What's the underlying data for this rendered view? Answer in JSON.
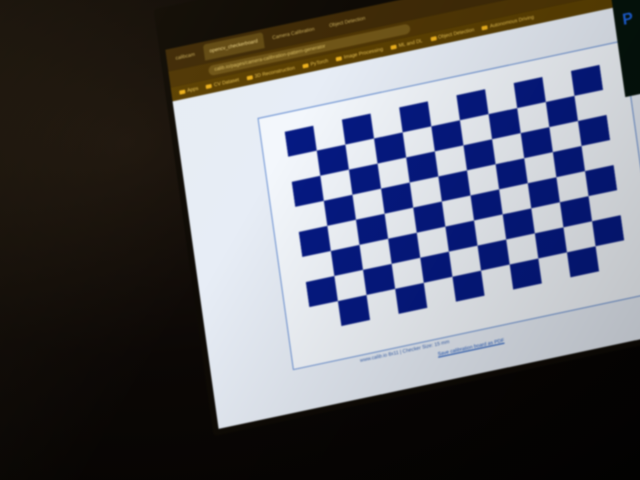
{
  "scene": {
    "background_color": "#050302",
    "screen_tint": "#e8edf4"
  },
  "browser": {
    "tabs": [
      {
        "label": "calibcam",
        "state": "normal"
      },
      {
        "label": "opencv_checkerboard",
        "state": "active"
      },
      {
        "label": "Camera Calibration",
        "state": "normal"
      },
      {
        "label": "Object Detection",
        "state": "normal"
      }
    ],
    "url": "calib.io/pages/camera-calibration-pattern-generator",
    "bookmarks": [
      "Apps",
      "CV Dataset",
      "3D Reconstruction",
      "PyTorch",
      "Image Processing",
      "ML and DL",
      "Object Detection",
      "Autonomous Driving"
    ]
  },
  "pattern": {
    "type": "Checkerboard",
    "rows": 8,
    "columns": 11,
    "square_color": "#0a1a6e",
    "paper_color": "#f4f7fb",
    "caption": "www.calib.io  8x11 | Checker Size: 15 mm",
    "save_label": "Save calibration board as PDF"
  },
  "sidebar": {
    "glyph": "P",
    "accent": "#2a62c4"
  }
}
